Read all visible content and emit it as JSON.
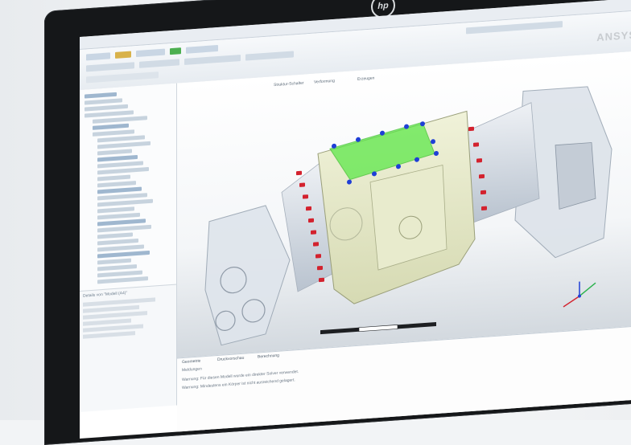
{
  "monitor": {
    "brand_logo": "hp"
  },
  "app": {
    "vendor_logo": "ANSYS",
    "viewport_toolbar": [
      "Struktur-Schalter",
      "Verformung",
      "Erzeugen"
    ],
    "details_title": "Details von \"Modell (A4)\"",
    "message_tabs": [
      "Geometrie",
      "Druckvorschau",
      "Berechnung"
    ],
    "messages_header": "Meldungen",
    "messages": [
      "Warnung: Für diesen Modell wurde ein direkter Solver verwendet.",
      "Warnung: Mindestens ein Körper ist nicht ausreichend gelagert."
    ]
  },
  "colors": {
    "model_body": "#e4e7c8",
    "highlight": "#5ee84a",
    "bolts_red": "#d3222e",
    "bolts_blue": "#1f3fd6",
    "housing": "#d6dde6"
  },
  "icons": [
    "tree-folder-icon",
    "axis-triad-icon",
    "toolbar-button-icon"
  ]
}
